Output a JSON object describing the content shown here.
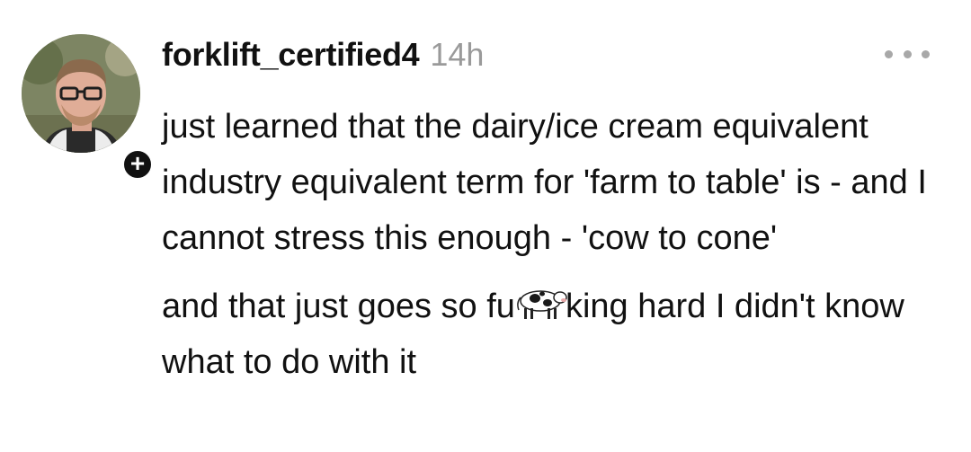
{
  "post": {
    "username": "forklift_certified4",
    "timestamp": "14h",
    "follow_icon": "plus-icon",
    "follow_symbol": "+",
    "more_icon": "more-dots-icon",
    "paragraph1": "just learned that the dairy/ice cream equivalent industry equivalent term for 'farm to table' is - and I cannot stress this enough - 'cow to cone'",
    "paragraph2_start": "and that just goes so fu",
    "paragraph2_emoji": "cow-emoji-icon",
    "paragraph2_end": "king hard I didn't know what to do with it"
  },
  "colors": {
    "text": "#111111",
    "timestamp": "#9a9a9a",
    "dots": "#a8a8a8",
    "badge": "#111111"
  }
}
